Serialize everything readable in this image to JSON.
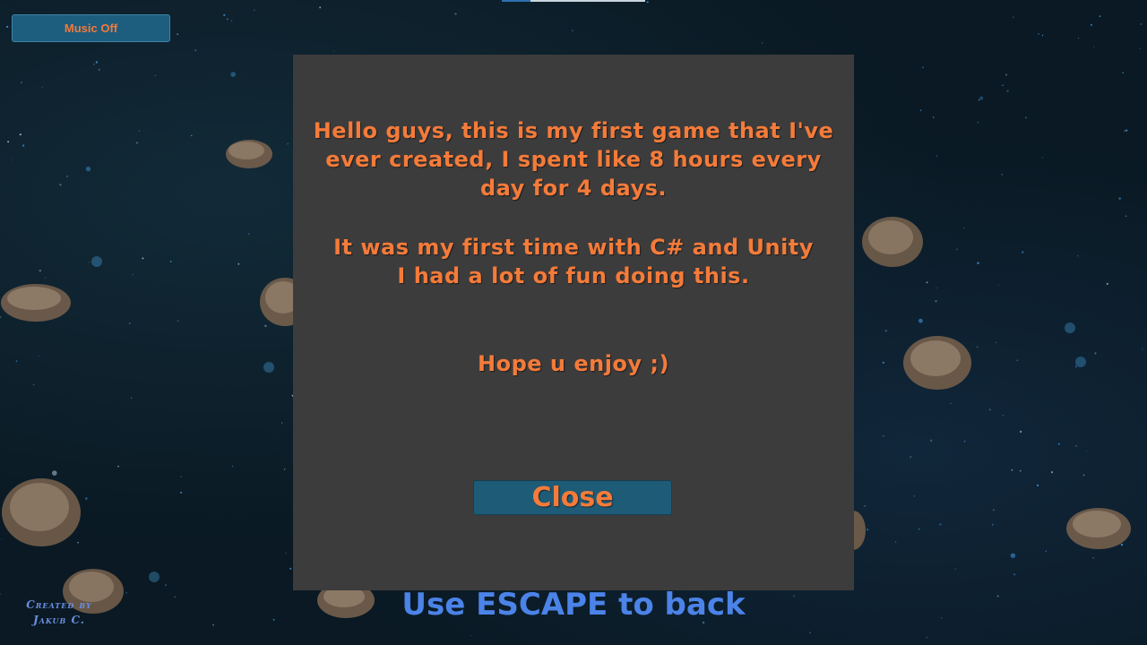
{
  "music_button": {
    "label": "Music Off"
  },
  "dialog": {
    "message_lines": [
      "Hello guys, this is my first game that I've",
      "ever created, I spent like 8 hours every",
      "day for 4 days.",
      "It was my first time with C# and Unity",
      "I had a lot of fun doing this.",
      "Hope u enjoy ;)"
    ],
    "close_label": "Close"
  },
  "hint": {
    "text": "Use ESCAPE to back"
  },
  "credits": {
    "line1": "Created by",
    "line2": "Jakub C."
  },
  "colors": {
    "accent_text": "#f47b3a",
    "button_bg": "#1e5b77",
    "panel_bg": "#3d3c3c",
    "hint_text": "#4b83e8",
    "space_bg": "#0a1923"
  }
}
